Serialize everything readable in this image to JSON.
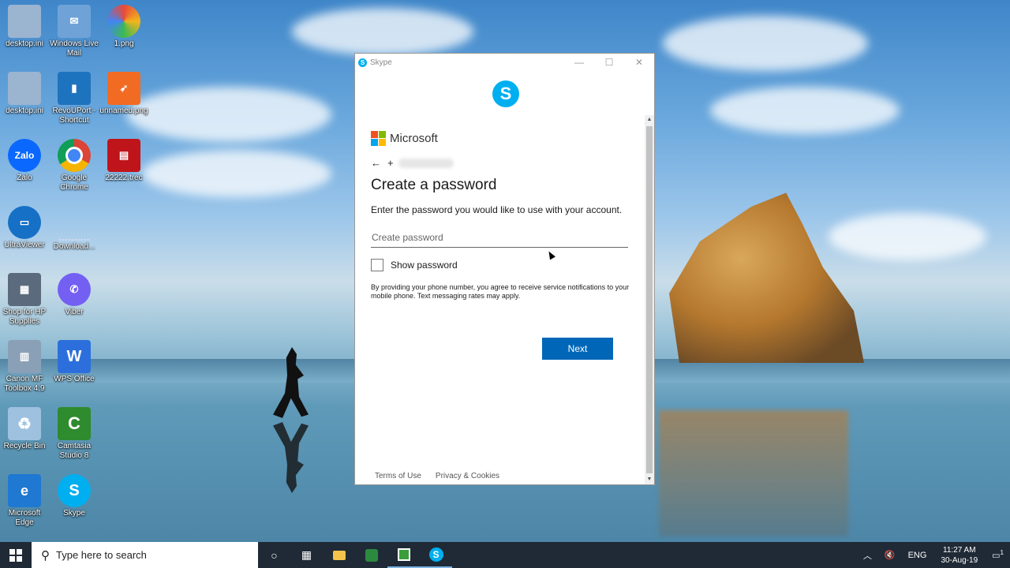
{
  "desktop": {
    "icons": [
      {
        "label": "desktop.ini",
        "glyph": "",
        "color": "#9bb4d0"
      },
      {
        "label": "Windows Live Mail",
        "glyph": "✉",
        "color": "#6fa3d8"
      },
      {
        "label": "1.png",
        "glyph": "",
        "color": "#e8493a"
      },
      {
        "label": "desktop.ini",
        "glyph": "",
        "color": "#9bb4d0"
      },
      {
        "label": "RevoUPort - Shortcut",
        "glyph": "▮",
        "color": "#1e73be"
      },
      {
        "label": "unnamed.png",
        "glyph": "➶",
        "color": "#f26b22"
      },
      {
        "label": "Zalo",
        "glyph": "Zalo",
        "color": "#0a68ff"
      },
      {
        "label": "Google Chrome",
        "glyph": "◉",
        "color": "#db4437"
      },
      {
        "label": "22222.trec",
        "glyph": "▤",
        "color": "#c0141b"
      },
      {
        "label": "UltraViewer",
        "glyph": "▭",
        "color": "#1670c6"
      },
      {
        "label": "Download...",
        "glyph": "",
        "color": "#d8dde3"
      },
      {
        "label": "Shop for HP Supplies",
        "glyph": "▦",
        "color": "#5b6b7d"
      },
      {
        "label": "Viber",
        "glyph": "✆",
        "color": "#7360f2"
      },
      {
        "label": "Canon MF Toolbox 4.9",
        "glyph": "▥",
        "color": "#8aa0b6"
      },
      {
        "label": "WPS Office",
        "glyph": "W",
        "color": "#2c6fdc"
      },
      {
        "label": "Recycle Bin",
        "glyph": "♻",
        "color": "#9ec1e0"
      },
      {
        "label": "Camtasia Studio 8",
        "glyph": "C",
        "color": "#2e8b2e"
      },
      {
        "label": "Microsoft Edge",
        "glyph": "e",
        "color": "#1f78d1"
      },
      {
        "label": "Skype",
        "glyph": "S",
        "color": "#00aff0"
      }
    ]
  },
  "window": {
    "title": "Skype",
    "logo_glyph": "S",
    "controls": {
      "minimize": "—",
      "maximize": "☐",
      "close": "✕"
    }
  },
  "signin": {
    "brand": "Microsoft",
    "back_arrow": "←",
    "phone_prefix": "+",
    "heading": "Create a password",
    "description": "Enter the password you would like to use with your account.",
    "password_placeholder": "Create password",
    "show_password_label": "Show password",
    "disclaimer": "By providing your phone number, you agree to receive service notifications to your mobile phone. Text messaging rates may apply.",
    "next_label": "Next",
    "terms_label": "Terms of Use",
    "privacy_label": "Privacy & Cookies"
  },
  "taskbar": {
    "search_placeholder": "Type here to search",
    "language": "ENG",
    "time": "11:27 AM",
    "date": "30-Aug-19",
    "notification_count": "1"
  },
  "colors": {
    "accent": "#0067b8",
    "skype": "#00aff0",
    "taskbar": "#1f2a36"
  }
}
